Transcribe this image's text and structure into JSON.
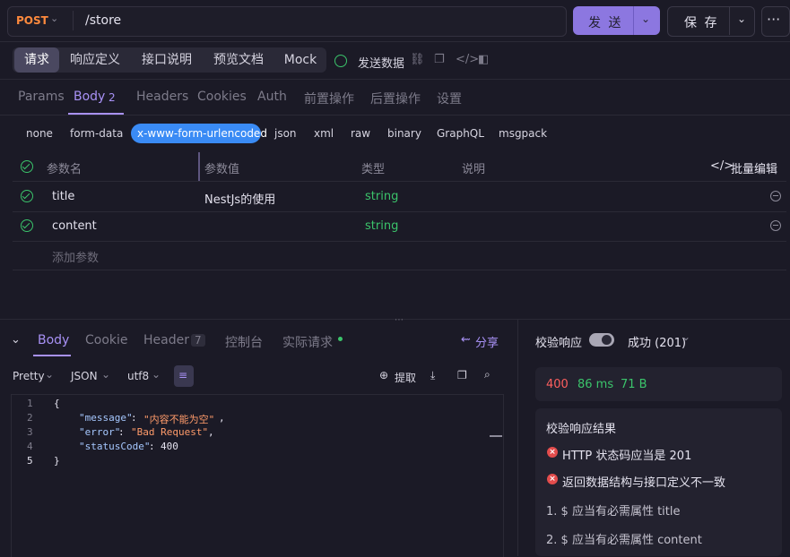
{
  "request": {
    "method": "POST",
    "url": "/store",
    "send_label": "发 送",
    "save_label": "保 存",
    "more_label": "···"
  },
  "section_tabs": [
    {
      "label": "请求",
      "active": true
    },
    {
      "label": "响应定义",
      "active": false
    },
    {
      "label": "接口说明",
      "active": false
    },
    {
      "label": "预览文档",
      "active": false
    },
    {
      "label": "Mock",
      "active": false
    }
  ],
  "send_data_label": "发送数据",
  "request_tabs": [
    {
      "label": "Params"
    },
    {
      "label": "Body",
      "badge": "2",
      "active": true
    },
    {
      "label": "Headers"
    },
    {
      "label": "Cookies"
    },
    {
      "label": "Auth"
    },
    {
      "label": "前置操作"
    },
    {
      "label": "后置操作"
    },
    {
      "label": "设置"
    }
  ],
  "body_types": [
    "none",
    "form-data",
    "x-www-form-urlencoded",
    "json",
    "xml",
    "raw",
    "binary",
    "GraphQL",
    "msgpack"
  ],
  "body_type_selected": "x-www-form-urlencoded",
  "params_table": {
    "headers": {
      "name": "参数名",
      "value": "参数值",
      "type": "类型",
      "desc": "说明",
      "bulk_edit": "批量编辑"
    },
    "rows": [
      {
        "name": "title",
        "value": "NestJs的使用",
        "type": "string",
        "desc": ""
      },
      {
        "name": "content",
        "value": "",
        "type": "string",
        "desc": ""
      }
    ],
    "add_placeholder": "添加参数"
  },
  "response_tabs": [
    {
      "label": "Body",
      "active": true
    },
    {
      "label": "Cookie"
    },
    {
      "label": "Header",
      "badge": "7"
    },
    {
      "label": "控制台"
    },
    {
      "label": "实际请求"
    }
  ],
  "share_label": "分享",
  "response_toolbar": {
    "format": "Pretty",
    "lang": "JSON",
    "encoding": "utf8",
    "extract_label": "提取"
  },
  "response_code": {
    "line_numbers": [
      "1",
      "2",
      "3",
      "4",
      "5"
    ],
    "open_brace": "{",
    "message_key": "\"message\"",
    "message_value": "\"内容不能为空\"",
    "error_key": "\"error\"",
    "error_value": "\"Bad Request\"",
    "status_key": "\"statusCode\"",
    "status_value": "400",
    "close_brace": "}"
  },
  "validation": {
    "label": "校验响应",
    "toggle_on": true,
    "schema": "成功 (201)",
    "status_code": "400",
    "time": "86 ms",
    "size": "71 B",
    "result_title": "校验响应结果",
    "errors": [
      "HTTP 状态码应当是 201",
      "返回数据结构与接口定义不一致"
    ],
    "details": [
      "1. $ 应当有必需属性 title",
      "2. $ 应当有必需属性 content"
    ]
  },
  "colors": {
    "accent": "#a891f5",
    "send_button": "#8c77e0",
    "method": "#ff8a3d",
    "type_green": "#3bc46b",
    "error_red": "#e34c4c",
    "selected_body_type": "#3a8bf5"
  }
}
